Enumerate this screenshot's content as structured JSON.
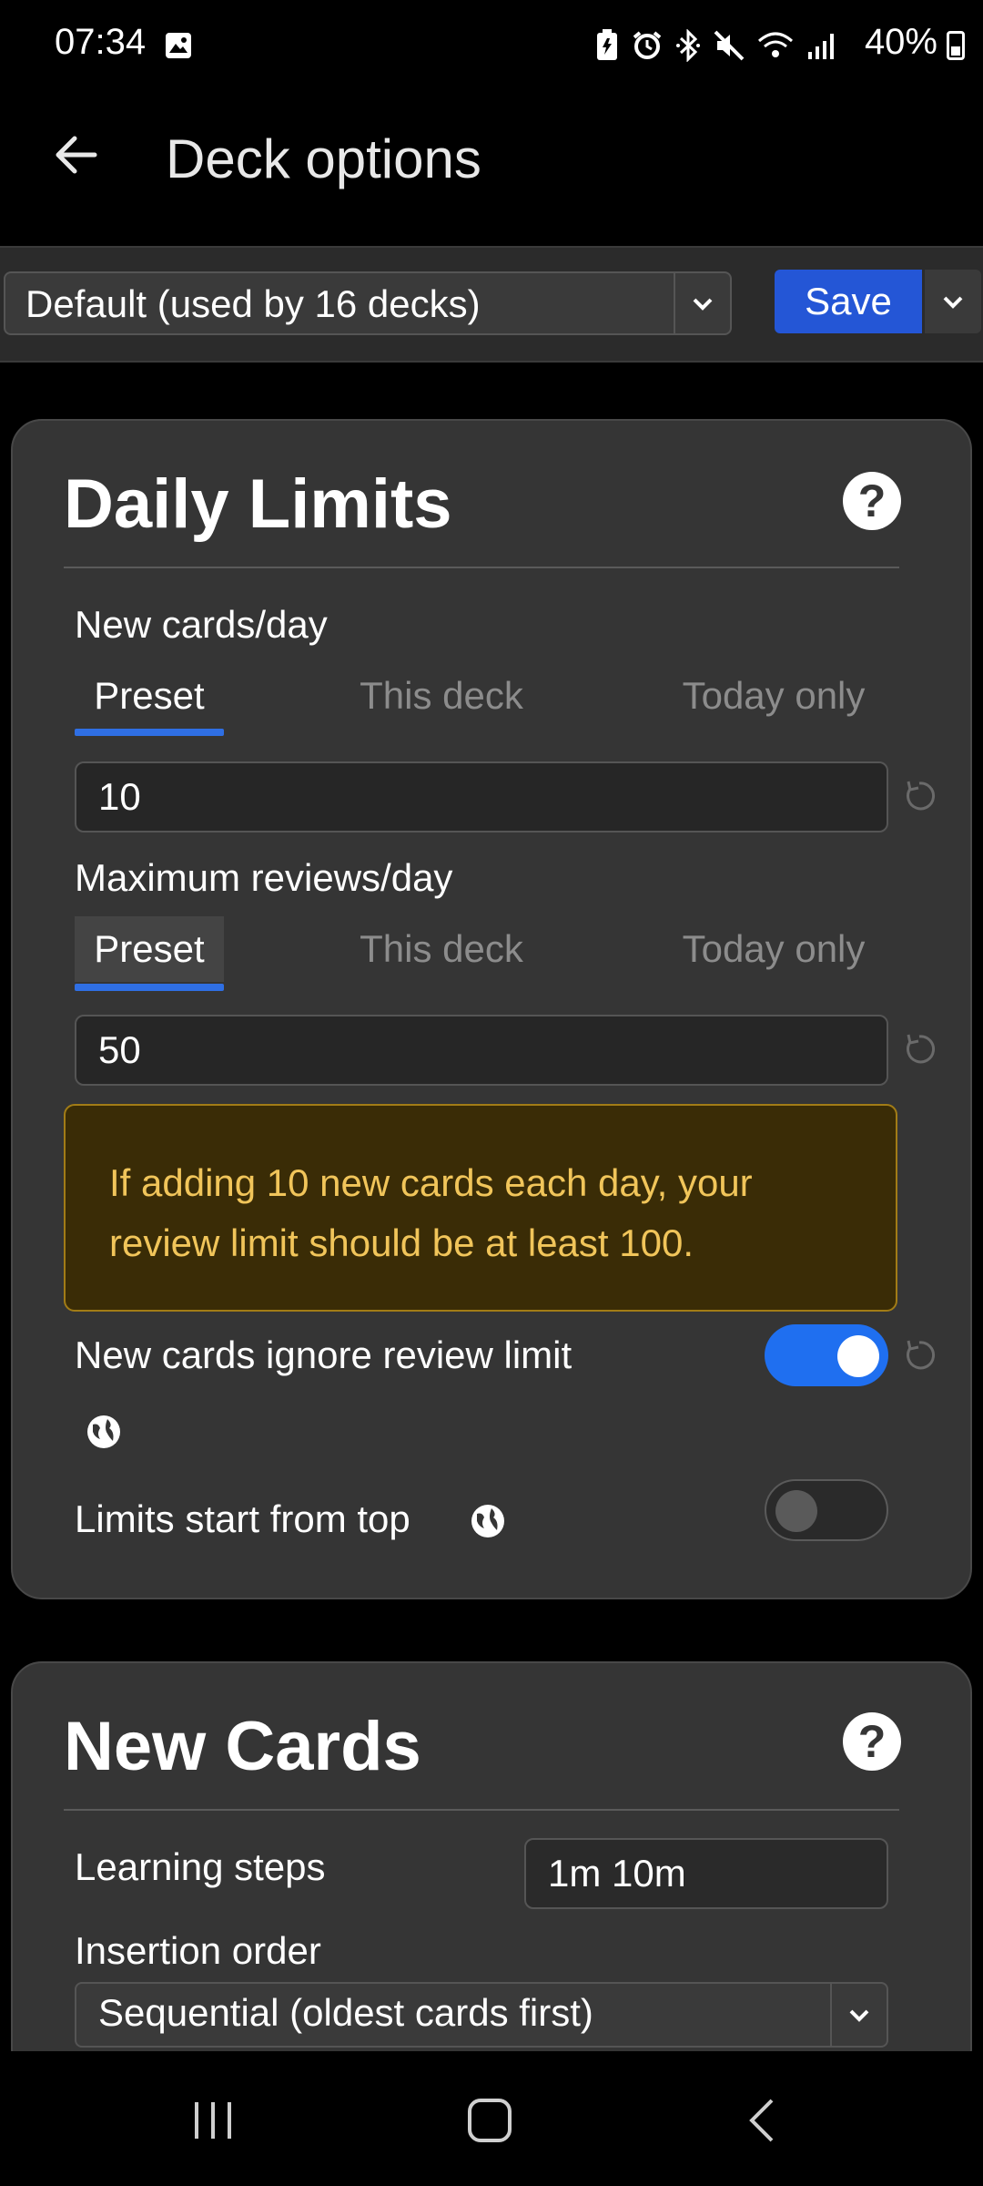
{
  "status_bar": {
    "time": "07:34",
    "battery_text": "40%",
    "icons": [
      "image-icon",
      "battery-saver-icon",
      "alarm-icon",
      "bluetooth-icon",
      "mute-icon",
      "wifi-icon",
      "signal-icon",
      "battery-icon"
    ]
  },
  "app_bar": {
    "title": "Deck options",
    "back_icon": "arrow-left-icon"
  },
  "preset_bar": {
    "selected_preset": "Default (used by 16 decks)",
    "save_label": "Save"
  },
  "daily_limits": {
    "title": "Daily Limits",
    "new_cards": {
      "label": "New cards/day",
      "tabs": [
        "Preset",
        "This deck",
        "Today only"
      ],
      "active_tab": "Preset",
      "value": "10"
    },
    "max_reviews": {
      "label": "Maximum reviews/day",
      "tabs": [
        "Preset",
        "This deck",
        "Today only"
      ],
      "active_tab": "Preset",
      "value": "50"
    },
    "warning": "If adding 10 new cards each day, your review limit should be at least 100.",
    "ignore_review_limit": {
      "label": "New cards ignore review limit",
      "enabled": true
    },
    "limits_from_top": {
      "label": "Limits start from top",
      "enabled": false
    }
  },
  "new_cards_section": {
    "title": "New Cards",
    "learning_steps_label": "Learning steps",
    "learning_steps_value": "1m 10m",
    "insertion_order_label": "Insertion order",
    "insertion_order_value": "Sequential (oldest cards first)"
  },
  "colors": {
    "accent": "#2f6fe4",
    "save_button": "#2456d6",
    "card_bg": "#353535",
    "warning_bg": "#3a2c06",
    "warning_text": "#f1c55a"
  }
}
